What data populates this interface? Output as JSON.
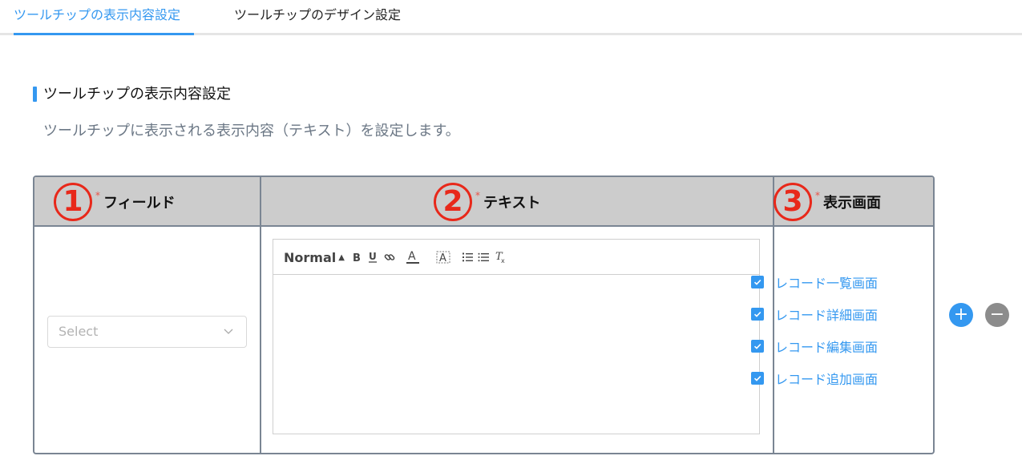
{
  "tabs": [
    {
      "label": "ツールチップの表示内容設定",
      "active": true
    },
    {
      "label": "ツールチップのデザイン設定",
      "active": false
    }
  ],
  "section": {
    "title": "ツールチップの表示内容設定",
    "description": "ツールチップに表示される表示内容（テキスト）を設定します。"
  },
  "table": {
    "columns": [
      {
        "number": "1",
        "required": "*",
        "label": "フィールド"
      },
      {
        "number": "2",
        "required": "*",
        "label": "テキスト"
      },
      {
        "number": "3",
        "required": "*",
        "label": "表示画面"
      }
    ]
  },
  "field_select": {
    "placeholder": "Select"
  },
  "editor": {
    "format_label": "Normal",
    "tools": [
      "bold-icon",
      "underline-icon",
      "link-icon",
      "text-color-icon",
      "background-color-icon",
      "ordered-list-icon",
      "bullet-list-icon",
      "clear-format-icon"
    ],
    "content": ""
  },
  "screens": [
    {
      "label": "レコード一覧画面",
      "checked": true
    },
    {
      "label": "レコード詳細画面",
      "checked": true
    },
    {
      "label": "レコード編集画面",
      "checked": true
    },
    {
      "label": "レコード追加画面",
      "checked": true
    }
  ],
  "row_actions": {
    "add": "+",
    "remove": "−"
  },
  "colors": {
    "accent": "#3498f0",
    "header_bg": "#cccccc",
    "border": "#7a8593",
    "annotation": "#e8281a"
  }
}
